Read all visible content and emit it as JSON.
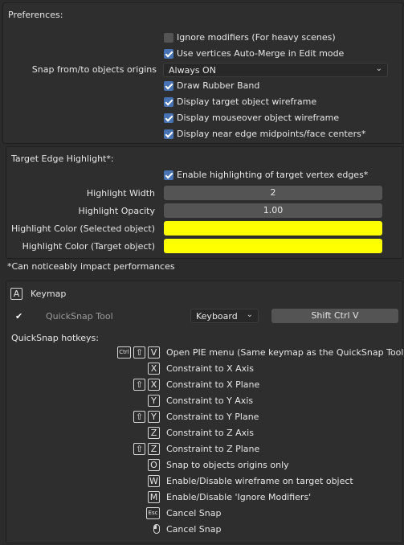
{
  "preferences": {
    "title": "Preferences:",
    "ignore_modifiers": {
      "label": "Ignore modifiers (For heavy scenes)",
      "checked": false
    },
    "auto_merge": {
      "label": "Use vertices Auto-Merge in Edit mode",
      "checked": true
    },
    "snap_origins": {
      "label": "Snap from/to objects origins",
      "value": "Always ON"
    },
    "rubber_band": {
      "label": "Draw Rubber Band",
      "checked": true
    },
    "target_wireframe": {
      "label": "Display target object wireframe",
      "checked": true
    },
    "mouseover_wireframe": {
      "label": "Display mouseover object wireframe",
      "checked": true
    },
    "near_edge": {
      "label": "Display near edge midpoints/face centers*",
      "checked": true
    }
  },
  "edge_highlight": {
    "title": "Target Edge Highlight*:",
    "enable": {
      "label": "Enable highlighting of target vertex edges*",
      "checked": true
    },
    "width": {
      "label": "Highlight Width",
      "value": "2"
    },
    "opacity": {
      "label": "Highlight Opacity",
      "value": "1.00"
    },
    "color_selected": {
      "label": "Highlight Color (Selected object)",
      "color": "#ffff00"
    },
    "color_target": {
      "label": "Highlight Color (Target object)",
      "color": "#ffff00"
    }
  },
  "footnote": "*Can noticeably impact performances",
  "keymap": {
    "header_icon": "A",
    "title": "Keymap",
    "tool_label": "QuickSnap Tool",
    "tool_enabled": true,
    "input_type": "Keyboard",
    "shortcut": "Shift Ctrl V",
    "hotkeys_title": "QuickSnap hotkeys:",
    "hotkeys": [
      {
        "keys": [
          "Ctrl",
          "shift-icon",
          "V"
        ],
        "desc": "Open PIE menu (Same keymap as the QuickSnap Tool)"
      },
      {
        "keys": [
          "X"
        ],
        "desc": "Constraint to X Axis"
      },
      {
        "keys": [
          "shift-icon",
          "X"
        ],
        "desc": "Constraint to X Plane"
      },
      {
        "keys": [
          "Y"
        ],
        "desc": "Constraint to Y Axis"
      },
      {
        "keys": [
          "shift-icon",
          "Y"
        ],
        "desc": "Constraint to Y Plane"
      },
      {
        "keys": [
          "Z"
        ],
        "desc": "Constraint to Z Axis"
      },
      {
        "keys": [
          "shift-icon",
          "Z"
        ],
        "desc": "Constraint to Z Plane"
      },
      {
        "keys": [
          "O"
        ],
        "desc": "Snap to objects origins only"
      },
      {
        "keys": [
          "W"
        ],
        "desc": "Enable/Disable wireframe on target object"
      },
      {
        "keys": [
          "M"
        ],
        "desc": "Enable/Disable 'Ignore Modifiers'"
      },
      {
        "keys": [
          "Esc"
        ],
        "desc": "Cancel Snap"
      },
      {
        "keys": [
          "mouse-right-icon"
        ],
        "desc": "Cancel Snap"
      }
    ]
  },
  "colors": {
    "accent": "#4772b3",
    "highlight": "#ffff00",
    "background": "#2b2b2b"
  }
}
